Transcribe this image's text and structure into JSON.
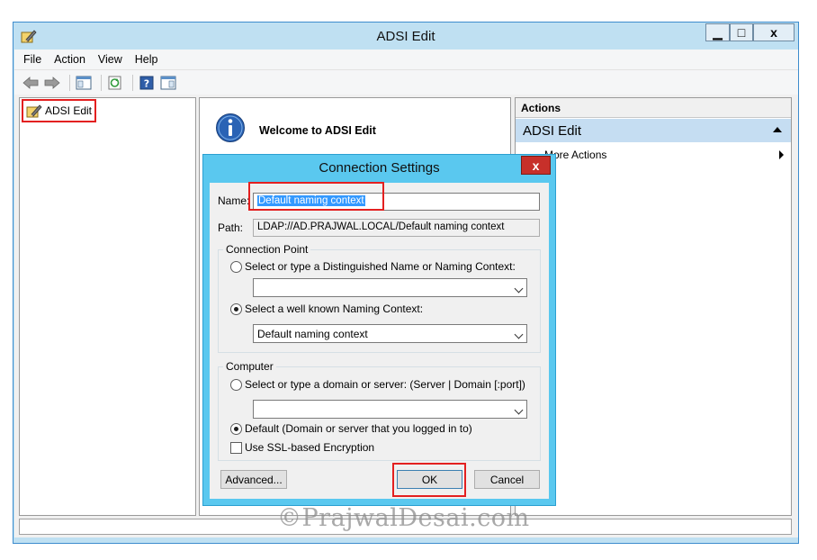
{
  "window": {
    "title": "ADSI Edit",
    "minimize_label": "▁",
    "maximize_label": "□",
    "close_label": "x"
  },
  "menu": [
    "File",
    "Action",
    "View",
    "Help"
  ],
  "toolbar": {
    "icons": [
      "back-arrow-icon",
      "forward-arrow-icon",
      "show-hide-console-tree-icon",
      "refresh-icon",
      "help-icon",
      "action-pane-icon"
    ]
  },
  "tree": {
    "root_label": "ADSI Edit"
  },
  "center": {
    "welcome_text": "Welcome to ADSI Edit"
  },
  "actions": {
    "header": "Actions",
    "group_title": "ADSI Edit",
    "more_actions": "More Actions"
  },
  "dialog": {
    "title": "Connection Settings",
    "close_label": "x",
    "name_label": "Name:",
    "name_value": "Default naming context",
    "path_label": "Path:",
    "path_value": "LDAP://AD.PRAJWAL.LOCAL/Default naming context",
    "connection_point": {
      "title": "Connection Point",
      "option_dn": "Select or type a Distinguished Name or Naming Context:",
      "dn_value": "",
      "option_wellknown": "Select a well known Naming Context:",
      "wellknown_value": "Default naming context",
      "selected": "wellknown"
    },
    "computer": {
      "title": "Computer",
      "option_server": "Select or type a domain or server: (Server | Domain [:port])",
      "server_value": "",
      "option_default": "Default (Domain or server that you logged in to)",
      "selected": "default",
      "ssl_label": "Use SSL-based Encryption",
      "ssl_checked": false
    },
    "buttons": {
      "advanced": "Advanced...",
      "ok": "OK",
      "cancel": "Cancel"
    }
  },
  "watermark": "©PrajwalDesai.com",
  "colors": {
    "dialog_frame": "#5ac8ef",
    "highlight_box": "#e32020",
    "selection": "#3399ff",
    "close_button": "#c7302a"
  }
}
